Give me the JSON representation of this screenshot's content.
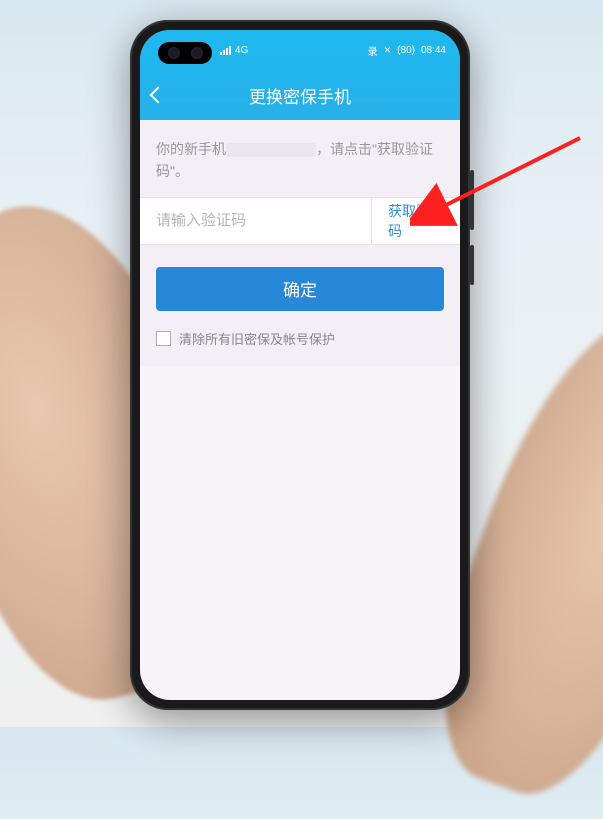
{
  "status": {
    "network": "4G",
    "recording_icon": "录",
    "battery_text": "(80)",
    "time": "08:44"
  },
  "header": {
    "title": "更换密保手机"
  },
  "hint": {
    "prefix": "你的新手机",
    "suffix": "，请点击\"获取验证码\"。"
  },
  "input": {
    "placeholder": "请输入验证码",
    "get_code_label": "获取验证码"
  },
  "confirm_label": "确定",
  "checkbox": {
    "label": "清除所有旧密保及帐号保护"
  },
  "colors": {
    "accent": "#28b0e8",
    "primary_button": "#2788d8",
    "link": "#2e8fd8"
  }
}
